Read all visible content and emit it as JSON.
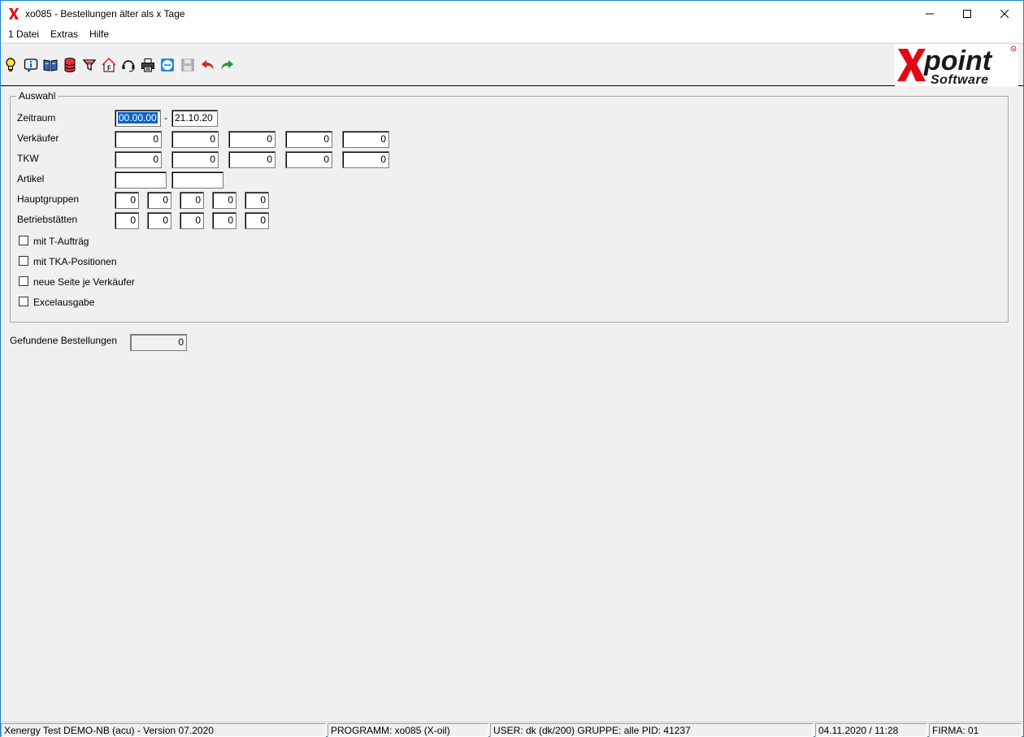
{
  "window": {
    "title": "xo085 - Bestellungen älter als x Tage"
  },
  "menu": {
    "items": [
      "1 Datei",
      "Extras",
      "Hilfe"
    ]
  },
  "toolbar": {
    "buttons": [
      "lightbulb-icon",
      "info-icon",
      "book-icon",
      "database-icon",
      "filter-icon",
      "home-f-icon",
      "headset-icon",
      "printer-icon",
      "teamviewer-icon",
      "save-icon",
      "undo-icon",
      "redo-icon"
    ]
  },
  "logo": {
    "brand": "Xpoint",
    "sub": "Software"
  },
  "form": {
    "group_title": "Auswahl",
    "zeitraum_label": "Zeitraum",
    "zeitraum_from": "00.00.00",
    "zeitraum_sep": "-",
    "zeitraum_to": "21.10.20",
    "verkaeufer_label": "Verkäufer",
    "verkaeufer_values": [
      "0",
      "0",
      "0",
      "0",
      "0"
    ],
    "tkw_label": "TKW",
    "tkw_values": [
      "0",
      "0",
      "0",
      "0",
      "0"
    ],
    "artikel_label": "Artikel",
    "artikel_values": [
      "",
      ""
    ],
    "hauptgruppen_label": "Hauptgruppen",
    "hauptgruppen_values": [
      "0",
      "0",
      "0",
      "0",
      "0"
    ],
    "betriebstaetten_label": "Betriebstätten",
    "betriebstaetten_values": [
      "0",
      "0",
      "0",
      "0",
      "0"
    ],
    "checkboxes": [
      {
        "label": "mit T-Aufträg",
        "checked": false
      },
      {
        "label": "mit TKA-Positionen",
        "checked": false
      },
      {
        "label": "neue Seite je Verkäufer",
        "checked": false
      },
      {
        "label": "Excelausgabe",
        "checked": false
      }
    ],
    "gefundene_label": "Gefundene Bestellungen",
    "gefundene_value": "0"
  },
  "status": {
    "version": "Xenergy Test DEMO-NB (acu) - Version 07.2020",
    "programm": "PROGRAMM: xo085 (X-oil)",
    "user": "USER: dk (dk/200)  GRUPPE: alle  PID: 41237",
    "datetime": "04.11.2020 / 11:28",
    "firma": "FIRMA: 01"
  },
  "colors": {
    "accent": "#1883d7",
    "selection": "#0a64c8",
    "logo_red": "#e30613",
    "logo_black": "#1a1a1a"
  }
}
